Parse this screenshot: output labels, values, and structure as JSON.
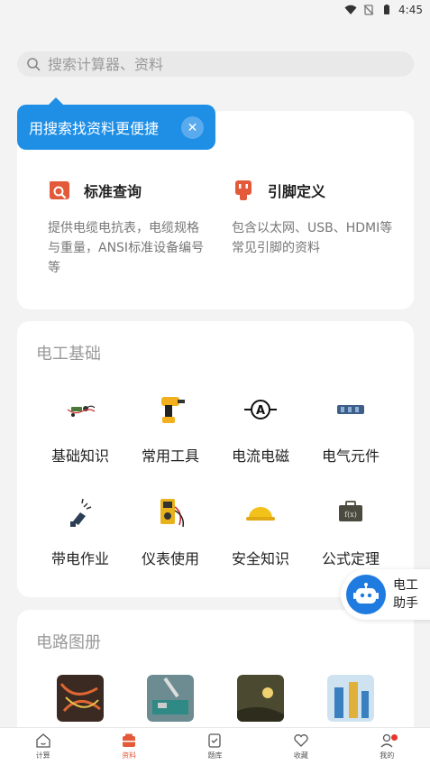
{
  "status": {
    "time": "4:45"
  },
  "search": {
    "placeholder": "搜索计算器、资料"
  },
  "tooltip": {
    "text": "用搜索找资料更便捷"
  },
  "features": [
    {
      "title": "标准查询",
      "desc": "提供电缆电抗表，电缆规格与重量，ANSI标准设备编号等",
      "icon": "search-doc-icon"
    },
    {
      "title": "引脚定义",
      "desc": "包含以太网、USB、HDMI等常见引脚的资料",
      "icon": "connector-icon"
    }
  ],
  "electrical": {
    "title": "电工基础",
    "items": [
      {
        "label": "基础知识",
        "icon": "basic-circuit-icon"
      },
      {
        "label": "常用工具",
        "icon": "drill-icon"
      },
      {
        "label": "电流电磁",
        "icon": "ammeter-icon"
      },
      {
        "label": "电气元件",
        "icon": "component-icon"
      },
      {
        "label": "带电作业",
        "icon": "live-work-icon"
      },
      {
        "label": "仪表使用",
        "icon": "multimeter-icon"
      },
      {
        "label": "安全知识",
        "icon": "helmet-icon"
      },
      {
        "label": "公式定理",
        "icon": "formula-case-icon"
      }
    ]
  },
  "circuit": {
    "title": "电路图册",
    "thumbs": [
      "wiring-photo",
      "pcb-photo",
      "welding-photo",
      "plant-photo"
    ]
  },
  "assistant": {
    "line1": "电工",
    "line2": "助手"
  },
  "nav": [
    {
      "label": "计算",
      "icon": "home-icon",
      "active": false
    },
    {
      "label": "资料",
      "icon": "folder-icon",
      "active": true
    },
    {
      "label": "题库",
      "icon": "quiz-icon",
      "active": false
    },
    {
      "label": "收藏",
      "icon": "heart-icon",
      "active": false
    },
    {
      "label": "我的",
      "icon": "user-icon",
      "active": false
    }
  ],
  "colors": {
    "accent": "#1f8fe6",
    "active_tab": "#e35a3b",
    "feature_icon": "#e35a3b"
  }
}
